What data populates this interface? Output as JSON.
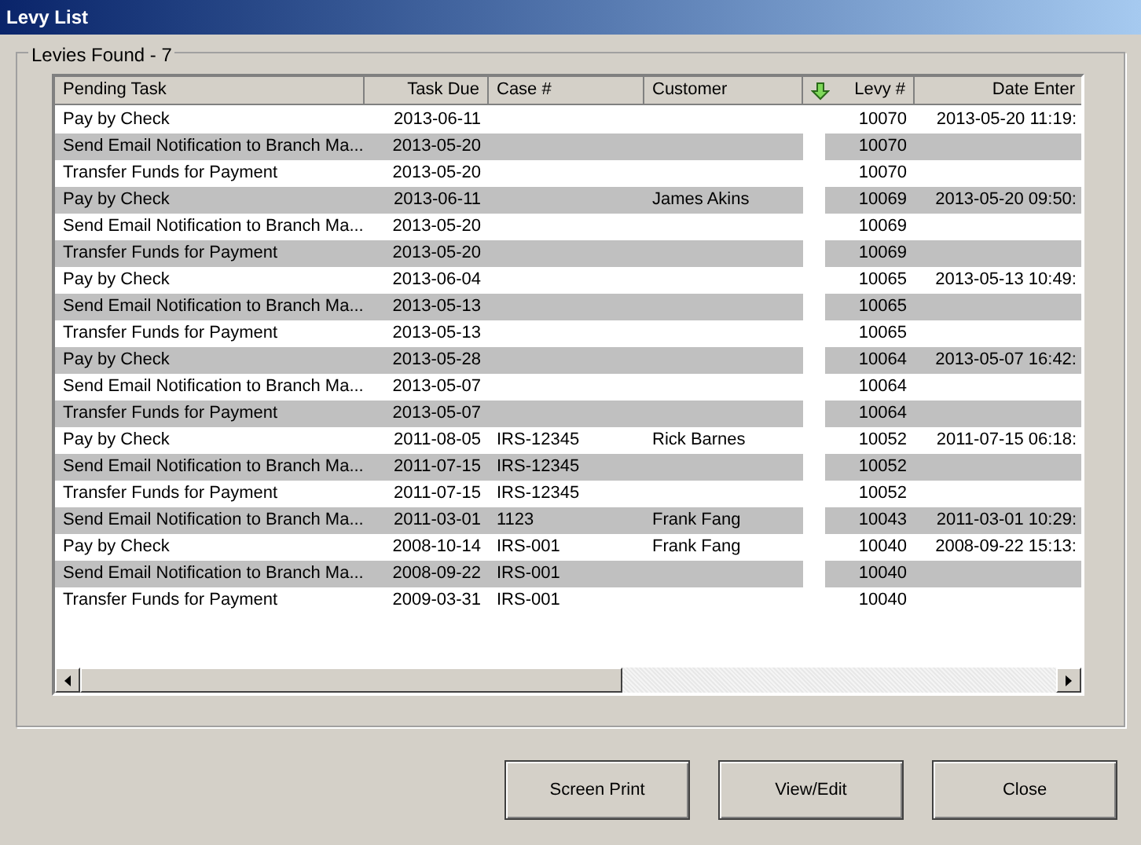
{
  "window": {
    "title": "Levy List"
  },
  "group": {
    "title": "Levies Found - 7"
  },
  "table": {
    "columns": [
      {
        "label": "Pending Task",
        "sorted": false
      },
      {
        "label": "Task Due",
        "sorted": false
      },
      {
        "label": "Case #",
        "sorted": false
      },
      {
        "label": "Customer",
        "sorted": false
      },
      {
        "label": "Levy #",
        "sorted": true
      },
      {
        "label": "Date Enter",
        "sorted": false
      }
    ],
    "rows": [
      {
        "shaded": false,
        "cells": [
          "Pay by Check",
          "2013-06-11",
          "",
          "",
          "10070",
          "2013-05-20 11:19:"
        ]
      },
      {
        "shaded": true,
        "cells": [
          "Send Email Notification to Branch Ma...",
          "2013-05-20",
          "",
          "",
          "10070",
          ""
        ]
      },
      {
        "shaded": false,
        "cells": [
          "Transfer Funds for Payment",
          "2013-05-20",
          "",
          "",
          "10070",
          ""
        ]
      },
      {
        "shaded": true,
        "cells": [
          "Pay by Check",
          "2013-06-11",
          "",
          "James Akins",
          "10069",
          "2013-05-20 09:50:"
        ]
      },
      {
        "shaded": false,
        "cells": [
          "Send Email Notification to Branch Ma...",
          "2013-05-20",
          "",
          "",
          "10069",
          ""
        ]
      },
      {
        "shaded": true,
        "cells": [
          "Transfer Funds for Payment",
          "2013-05-20",
          "",
          "",
          "10069",
          ""
        ]
      },
      {
        "shaded": false,
        "cells": [
          "Pay by Check",
          "2013-06-04",
          "",
          "",
          "10065",
          "2013-05-13 10:49:"
        ]
      },
      {
        "shaded": true,
        "cells": [
          "Send Email Notification to Branch Ma...",
          "2013-05-13",
          "",
          "",
          "10065",
          ""
        ]
      },
      {
        "shaded": false,
        "cells": [
          "Transfer Funds for Payment",
          "2013-05-13",
          "",
          "",
          "10065",
          ""
        ]
      },
      {
        "shaded": true,
        "cells": [
          "Pay by Check",
          "2013-05-28",
          "",
          "",
          "10064",
          "2013-05-07 16:42:"
        ]
      },
      {
        "shaded": false,
        "cells": [
          "Send Email Notification to Branch Ma...",
          "2013-05-07",
          "",
          "",
          "10064",
          ""
        ]
      },
      {
        "shaded": true,
        "cells": [
          "Transfer Funds for Payment",
          "2013-05-07",
          "",
          "",
          "10064",
          ""
        ]
      },
      {
        "shaded": false,
        "cells": [
          "Pay by Check",
          "2011-08-05",
          "IRS-12345",
          "Rick Barnes",
          "10052",
          "2011-07-15 06:18:"
        ]
      },
      {
        "shaded": true,
        "cells": [
          "Send Email Notification to Branch Ma...",
          "2011-07-15",
          "IRS-12345",
          "",
          "10052",
          ""
        ]
      },
      {
        "shaded": false,
        "cells": [
          "Transfer Funds for Payment",
          "2011-07-15",
          "IRS-12345",
          "",
          "10052",
          ""
        ]
      },
      {
        "shaded": true,
        "cells": [
          "Send Email Notification to Branch Ma...",
          "2011-03-01",
          "1123",
          "Frank Fang",
          "10043",
          "2011-03-01 10:29:"
        ]
      },
      {
        "shaded": false,
        "cells": [
          "Pay by Check",
          "2008-10-14",
          "IRS-001",
          "Frank Fang",
          "10040",
          "2008-09-22 15:13:"
        ]
      },
      {
        "shaded": true,
        "cells": [
          "Send Email Notification to Branch Ma...",
          "2008-09-22",
          "IRS-001",
          "",
          "10040",
          ""
        ]
      },
      {
        "shaded": false,
        "cells": [
          "Transfer Funds for Payment",
          "2009-03-31",
          "IRS-001",
          "",
          "10040",
          ""
        ]
      }
    ]
  },
  "buttons": [
    "Screen Print",
    "View/Edit",
    "Close"
  ]
}
